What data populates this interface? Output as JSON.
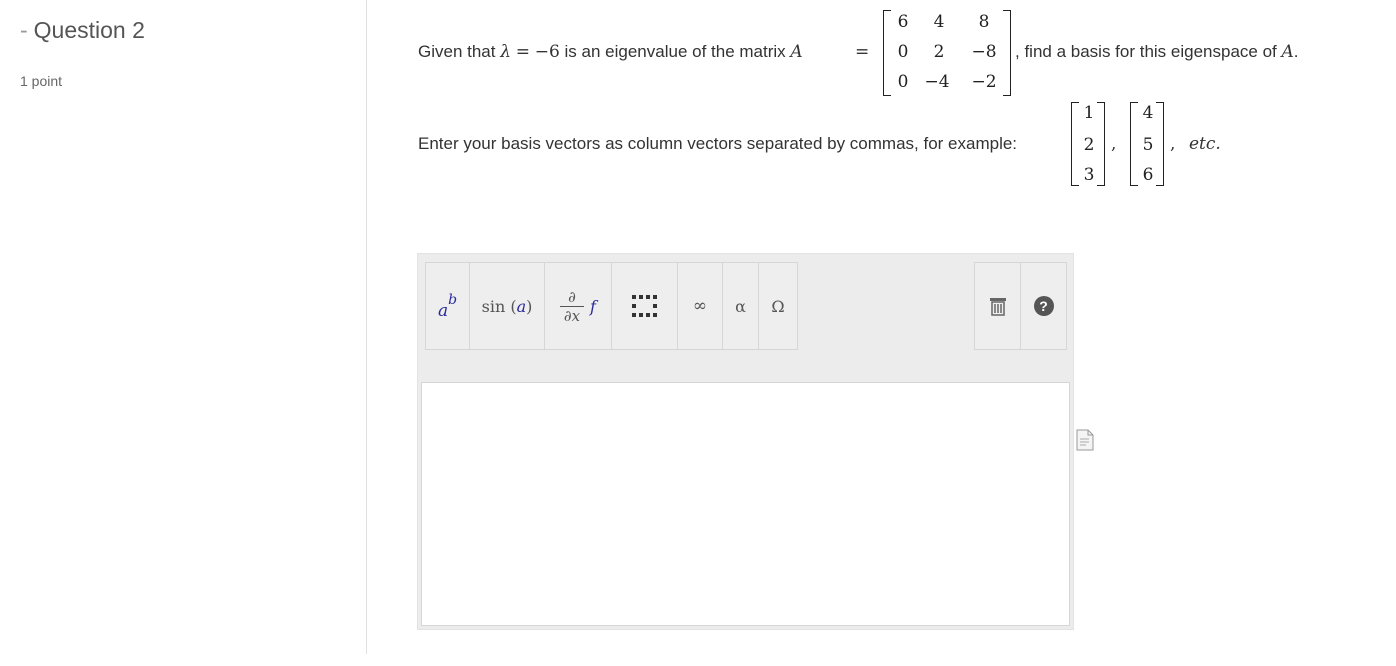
{
  "question": {
    "dash": "-",
    "title": "Question 2",
    "points": "1 point"
  },
  "prompt": {
    "given": "Given that",
    "lambda": "λ",
    "equals": "=",
    "value": "−6",
    "is_eigen": "is an eigenvalue of the matrix",
    "A": "A",
    "eq2": "=",
    "suffix": ", find a basis for this eigenspace of",
    "A2": "A",
    "period": ".",
    "matrix": [
      [
        "6",
        "4",
        "8"
      ],
      [
        "0",
        "2",
        "−8"
      ],
      [
        "0",
        "−4",
        "−2"
      ]
    ]
  },
  "instructions": {
    "text": "Enter your basis vectors as column vectors separated by commas, for example:",
    "v1": [
      "1",
      "2",
      "3"
    ],
    "v2": [
      "4",
      "5",
      "6"
    ],
    "comma1": ",",
    "comma2": ",",
    "etc": "etc."
  },
  "toolbar": {
    "power_base": "a",
    "power_exp": "b",
    "sin_label": "sin",
    "sin_arg": "a",
    "deriv_num": "∂",
    "deriv_den": "∂x",
    "deriv_f": "f",
    "matrix_glyph": "⋮⋮⋮",
    "infinity": "∞",
    "alpha": "α",
    "omega": "Ω",
    "help": "?"
  },
  "answer": {
    "value": ""
  }
}
